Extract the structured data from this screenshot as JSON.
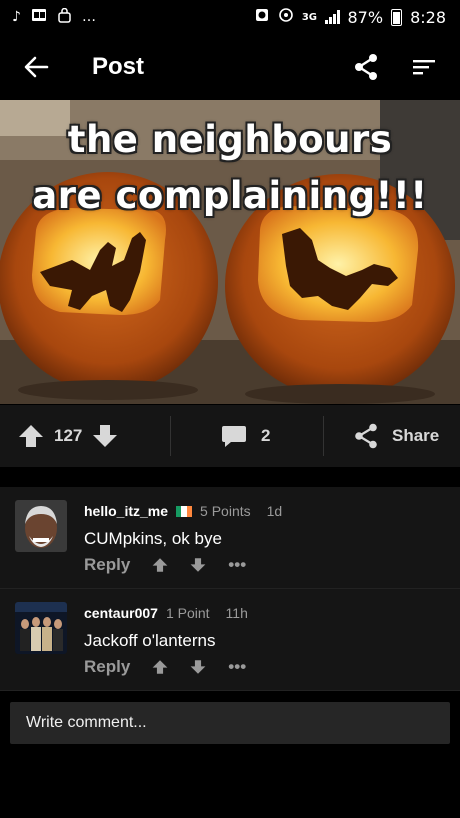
{
  "status_bar": {
    "battery": "87%",
    "time": "8:28",
    "network": "3G"
  },
  "app_bar": {
    "title": "Post"
  },
  "post": {
    "caption_line1": "the neighbours",
    "caption_line2": "are complaining!!!",
    "upvotes": "127",
    "comment_count": "2",
    "share_label": "Share"
  },
  "comments": [
    {
      "username": "hello_itz_me",
      "points": "5 Points",
      "age": "1d",
      "text": "CUMpkins, ok bye",
      "reply_label": "Reply",
      "more": "•••"
    },
    {
      "username": "centaur007",
      "points": "1 Point",
      "age": "11h",
      "text": "Jackoff o'lanterns",
      "reply_label": "Reply",
      "more": "•••"
    }
  ],
  "composer": {
    "placeholder": "Write comment..."
  },
  "colors": {
    "background": "#000000",
    "panel": "#151515",
    "muted": "#9a9a9a",
    "composer": "#262626"
  },
  "icons": [
    "music-note-icon",
    "outlook-icon",
    "bag-icon",
    "more-icon",
    "alarm-icon",
    "sync-icon",
    "signal-icon",
    "battery-icon",
    "back-arrow-icon",
    "share-icon",
    "sort-icon",
    "upvote-icon",
    "downvote-icon",
    "comment-icon"
  ]
}
